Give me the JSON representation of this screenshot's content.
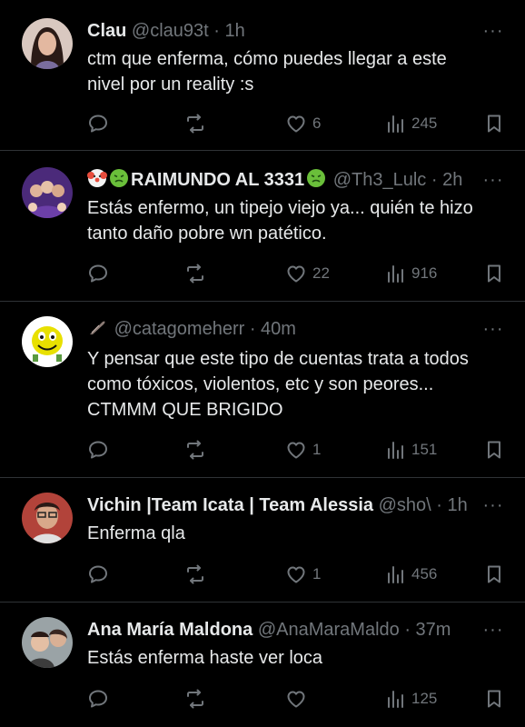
{
  "posts": [
    {
      "name": "Clau",
      "handle": "@clau93t",
      "time": "· 1h",
      "text": "ctm que enferma, cómo puedes llegar a este\nnivel por un reality :s",
      "replies": "",
      "retweets": "",
      "likes": "6",
      "views": "245",
      "avatar_bg": "#8b6a64"
    },
    {
      "name": "RAIMUNDO AL 3331",
      "handle": "@Th3_Lulc",
      "time": "· 2h",
      "text": "Estás enfermo, un tipejo viejo ya... quién te hizo\ntanto daño pobre wn patético.",
      "replies": "",
      "retweets": "",
      "likes": "22",
      "views": "916",
      "avatar_bg": "#4b2a7a"
    },
    {
      "name": "",
      "handle": "@catagomeherr",
      "time": "· 40m",
      "text": "Y pensar que este tipo de cuentas trata a todos\ncomo tóxicos, violentos, etc y son peores...\nCTMMM QUE BRIGIDO",
      "replies": "",
      "retweets": "",
      "likes": "1",
      "views": "151",
      "avatar_bg": "#ffffff"
    },
    {
      "name": "Vichin |Team Icata | Team Alessia",
      "handle": "@sho\\",
      "time": "· 1h",
      "text": "Enferma qla",
      "replies": "",
      "retweets": "",
      "likes": "1",
      "views": "456",
      "avatar_bg": "#b2433a"
    },
    {
      "name": "Ana María Maldona",
      "handle": "@AnaMaraMaldo",
      "time": "· 37m",
      "text": "Estás enferma haste ver loca",
      "replies": "",
      "retweets": "",
      "likes": "",
      "views": "125",
      "avatar_bg": "#9aa3a6"
    }
  ],
  "more_glyph": "···",
  "colors": {
    "background": "#000000",
    "text": "#e7e9ea",
    "muted": "#71767b",
    "divider": "#2f3336"
  }
}
